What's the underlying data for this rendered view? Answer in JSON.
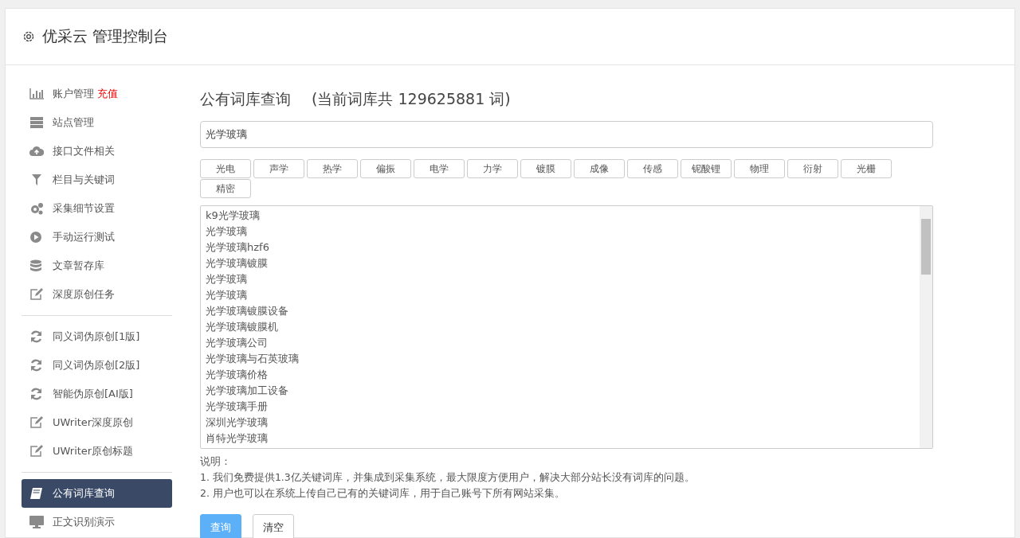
{
  "header": {
    "title": "优采云 管理控制台"
  },
  "sidebar": {
    "groups": [
      [
        {
          "label": "账户管理",
          "badge": "充值",
          "selected": false
        },
        {
          "label": "站点管理",
          "selected": false
        },
        {
          "label": "接口文件相关",
          "selected": false
        },
        {
          "label": "栏目与关键词",
          "selected": false
        },
        {
          "label": "采集细节设置",
          "selected": false
        },
        {
          "label": "手动运行测试",
          "selected": false
        },
        {
          "label": "文章暂存库",
          "selected": false
        },
        {
          "label": "深度原创任务",
          "selected": false
        }
      ],
      [
        {
          "label": "同义词伪原创[1版]",
          "selected": false
        },
        {
          "label": "同义词伪原创[2版]",
          "selected": false
        },
        {
          "label": "智能伪原创[AI版]",
          "selected": false
        },
        {
          "label": "UWriter深度原创",
          "selected": false
        },
        {
          "label": "UWriter原创标题",
          "selected": false
        }
      ],
      [
        {
          "label": "公有词库查询",
          "selected": true
        },
        {
          "label": "正文识别演示",
          "selected": false
        }
      ]
    ]
  },
  "main": {
    "heading": "公有词库查询",
    "count_note": "(当前词库共 129625881 词)",
    "search": {
      "value": "光学玻璃"
    },
    "tags": [
      "光电",
      "声学",
      "热学",
      "偏振",
      "电学",
      "力学",
      "镀膜",
      "成像",
      "传感",
      "铌酸锂",
      "物理",
      "衍射",
      "光栅",
      "精密"
    ],
    "results": [
      "k9光学玻璃",
      "光学玻璃",
      "光学玻璃hzf6",
      "光学玻璃镀膜",
      "光学玻璃",
      "光学玻璃",
      "光学玻璃镀膜设备",
      "光学玻璃镀膜机",
      "光学玻璃公司",
      "光学玻璃与石英玻璃",
      "光学玻璃价格",
      "光学玻璃加工设备",
      "光学玻璃手册",
      "深圳光学玻璃",
      "肖特光学玻璃"
    ],
    "notes_title": "说明：",
    "notes": [
      "1. 我们免费提供1.3亿关键词库，并集成到采集系统，最大限度方便用户，解决大部分站长没有词库的问题。",
      "2. 用户也可以在系统上传自己已有的关键词库，用于自己账号下所有网站采集。"
    ],
    "buttons": [
      {
        "label": "查询",
        "kind": "primary"
      },
      {
        "label": "清空",
        "kind": "default"
      }
    ]
  }
}
